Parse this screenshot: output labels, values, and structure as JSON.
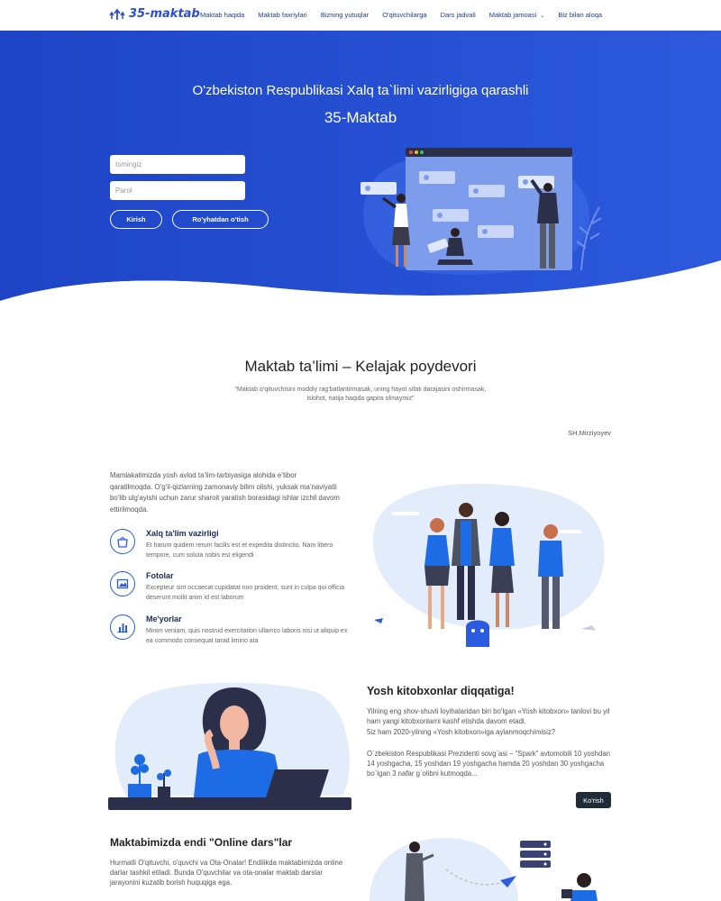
{
  "nav": {
    "logo": "35-maktab",
    "items": [
      {
        "label": "Maktab haqida"
      },
      {
        "label": "Maktab faxriylari"
      },
      {
        "label": "Bizning yutuqlar"
      },
      {
        "label": "O'qituvchilarga"
      },
      {
        "label": "Dars jadvali"
      },
      {
        "label": "Maktab jamoasi",
        "dropdown": true
      },
      {
        "label": "Biz bilan aloqa"
      }
    ]
  },
  "hero": {
    "subtitle": "O'zbekiston Respublikasi Xalq ta`limi vazirligiga qarashli",
    "title": "35-Maktab",
    "name_placeholder": "Ismingiz",
    "password_placeholder": "Parol",
    "login_label": "Kirish",
    "register_label": "Ro'yhatdan o'tish"
  },
  "motto": {
    "title": "Maktab ta’limi – Kelajak poydevori",
    "quote": "“Maktab o‘qituvchisini moddiy rag‘batlantirmasak, uning hayot sifati darajasini oshirmasak, islohot, natija haqida gapira olmaymiz”",
    "author": "SH.Mirziyoyev"
  },
  "features": {
    "intro": "Mamlakatimizda yosh avlod ta’lim-tarbiyasiga alohida e’tibor qaratilmoqda. O‘g‘il-qizlarning zamonaviy bilim olishi, yuksak ma’naviyatli bo‘lib ulg‘ayishi uchun zarur sharoit yaratish borasidagi ishlar izchil davom ettirilmoqda.",
    "items": [
      {
        "title": "Xalq ta'lim vazirligi",
        "desc": "Et harum quidem rerum facilis est et expedita distinctio. Nam libero tempore, cum soluta nobis est eligendi",
        "icon": "shopping-bag-icon"
      },
      {
        "title": "Fotolar",
        "desc": "Excepteur sint occaecat cupidatat non proident, sunt in culpa qui officia deserunt mollit anim id est laborum",
        "icon": "image-icon"
      },
      {
        "title": "Me'yorlar",
        "desc": "Minim veniam, quis nostrud exercitation ullamco laboris nisi ut aliquip ex ea commodo consequat tarad limino ata",
        "icon": "bar-chart-icon"
      }
    ]
  },
  "readers": {
    "title": "Yosh kitobxonlar diqqatiga!",
    "p1": "Yilning eng shov-shuvli loyihalaridan biri bo‘lgan «Yosh kitobxon» tanlovi bu yil ham yangi kitobxonlarni kashf etishda davom etadi.",
    "p1b": "5iz ham 2020-yilning «Yosh kitobxon»iga aylanmoqchimisiz?",
    "p2": "O`zbekiston Respublikasi Prezidenti sovg`asi – “Spark” avtomobili 10 yoshdan 14 yoshgacha, 15 yoshdan 19 yoshgacha hamda 20 yoshdan 30 yoshgacha bo`lgan 3 nafar g`olibni kutmoqda...",
    "button": "Ko'rish"
  },
  "online": {
    "title": "Maktabimizda endi \"Online dars\"lar",
    "p": "Hurmatli O'qituvchi, o'quvchi va Ota-Onalar! Endilikda maktabimizda online darlar tashkil etiladi. Bunda O'quvchilar va ota-onalar maktab darslar jarayonini kuzatib borish huquqiga ega."
  },
  "colors": {
    "hero_blue": "#1f47c9",
    "accent": "#2a5be0",
    "dark_button": "#1f2a3a"
  }
}
